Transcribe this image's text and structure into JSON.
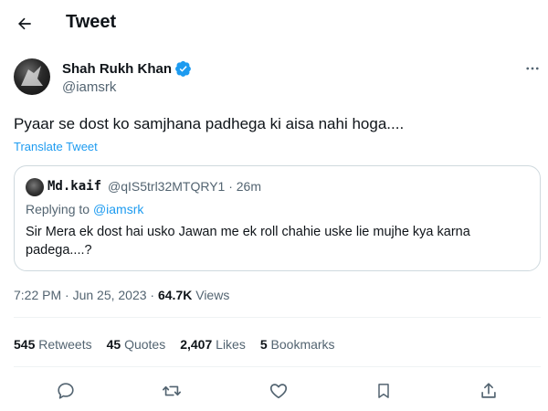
{
  "header": {
    "title": "Tweet",
    "back_icon": "arrow-left-icon"
  },
  "author": {
    "name": "Shah Rukh Khan",
    "handle": "@iamsrk",
    "verified": true,
    "verified_color": "#1d9bf0"
  },
  "tweet": {
    "text": "Pyaar se dost ko samjhana padhega ki aisa nahi hoga....",
    "translate_label": "Translate Tweet"
  },
  "quote": {
    "name": "Md.kaif",
    "handle_time": "@qIS5trl32MTQRY1 · 26m",
    "replying_prefix": "Replying to ",
    "replying_to": "@iamsrk",
    "text": "Sir Mera ek dost hai usko Jawan me ek roll chahie uske lie mujhe kya karna padega....?"
  },
  "meta": {
    "time": "7:22 PM · Jun 25, 2023 · ",
    "views_count": "64.7K",
    "views_label": " Views"
  },
  "stats": {
    "retweets_count": "545",
    "retweets_label": " Retweets",
    "quotes_count": "45",
    "quotes_label": " Quotes",
    "likes_count": "2,407",
    "likes_label": " Likes",
    "bookmarks_count": "5",
    "bookmarks_label": " Bookmarks"
  },
  "colors": {
    "link": "#1d9bf0",
    "muted": "#536471",
    "text": "#0f1419",
    "border": "#cfd9de"
  }
}
